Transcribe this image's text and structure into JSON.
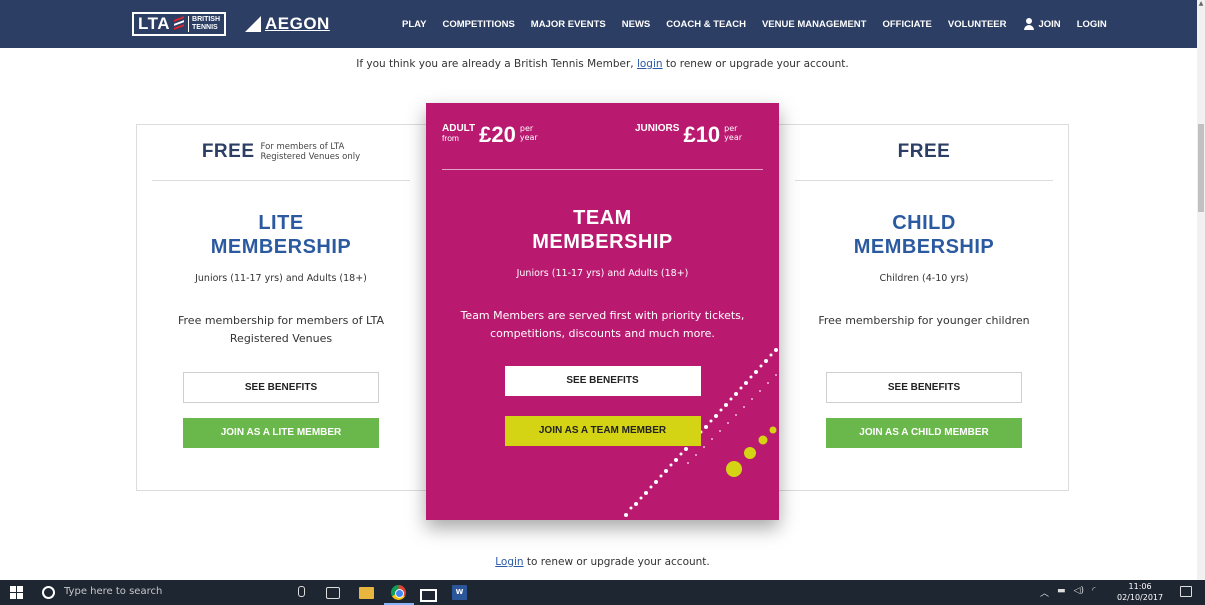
{
  "nav": {
    "logo_lta": "LTA",
    "logo_british": "BRITISH",
    "logo_tennis": "TENNIS",
    "logo_aegon": "AEGON",
    "items": [
      "PLAY",
      "COMPETITIONS",
      "MAJOR EVENTS",
      "NEWS",
      "COACH & TEACH",
      "VENUE MANAGEMENT",
      "OFFICIATE",
      "VOLUNTEER"
    ],
    "join": "JOIN",
    "login": "LOGIN"
  },
  "top_message": {
    "before": "If you think you are already a British Tennis Member, ",
    "link": "login",
    "after": " to renew or upgrade your account."
  },
  "lite": {
    "price": "FREE",
    "price_note_1": "For members of LTA",
    "price_note_2": "Registered Venues only",
    "title_1": "LITE",
    "title_2": "MEMBERSHIP",
    "subtitle": "Juniors (11-17 yrs) and Adults (18+)",
    "description": "Free membership for members of LTA Registered Venues",
    "benefits_button": "SEE BENEFITS",
    "join_button": "JOIN AS A LITE MEMBER"
  },
  "team": {
    "adult_label": "ADULT",
    "adult_from": "from",
    "adult_price": "£20",
    "adult_per_1": "per",
    "adult_per_2": "year",
    "juniors_label": "JUNIORS",
    "juniors_price": "£10",
    "juniors_per_1": "per",
    "juniors_per_2": "year",
    "title_1": "TEAM",
    "title_2": "MEMBERSHIP",
    "subtitle": "Juniors (11-17 yrs) and Adults (18+)",
    "description": "Team Members are served first with priority tickets, competitions, discounts and much more.",
    "benefits_button": "SEE BENEFITS",
    "join_button": "JOIN AS A TEAM MEMBER"
  },
  "child": {
    "price": "FREE",
    "title_1": "CHILD",
    "title_2": "MEMBERSHIP",
    "subtitle": "Children (4-10 yrs)",
    "description": "Free membership for younger children",
    "benefits_button": "SEE BENEFITS",
    "join_button": "JOIN AS A CHILD MEMBER"
  },
  "bottom_message": {
    "link": "Login",
    "after": " to renew or upgrade your account."
  },
  "taskbar": {
    "search_placeholder": "Type here to search",
    "word_icon_label": "W",
    "time": "11:06",
    "date": "02/10/2017"
  },
  "colors": {
    "nav_bg": "#2c3e63",
    "team_bg": "#b9196f",
    "lite_green": "#6ab84c",
    "team_yellow": "#d4d414",
    "title_blue": "#2c5aa0"
  }
}
